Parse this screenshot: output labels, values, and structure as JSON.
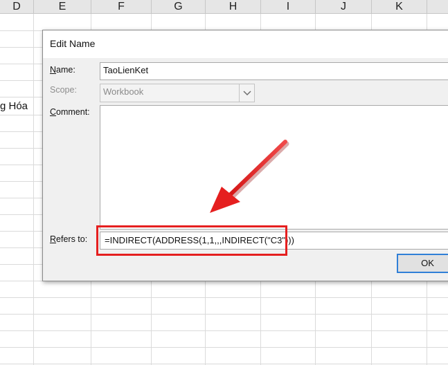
{
  "spreadsheet": {
    "columns": [
      "D",
      "E",
      "F",
      "G",
      "H",
      "I",
      "J",
      "K"
    ],
    "visible_cell_text": "g Hóa"
  },
  "dialog": {
    "title": "Edit Name",
    "name_label_key": "N",
    "name_label_rest": "ame:",
    "name_value": "TaoLienKet",
    "scope_label": "Scope:",
    "scope_value": "Workbook",
    "comment_label_key": "C",
    "comment_label_rest": "omment:",
    "comment_value": "",
    "refers_label_key": "R",
    "refers_label_rest": "efers to:",
    "refers_value": "=INDIRECT(ADDRESS(1,1,,,INDIRECT(\"C3\")))",
    "ok_label": "OK"
  },
  "annotation": {
    "highlight_color": "#e51f1f",
    "arrow_color": "#e51f1f"
  }
}
